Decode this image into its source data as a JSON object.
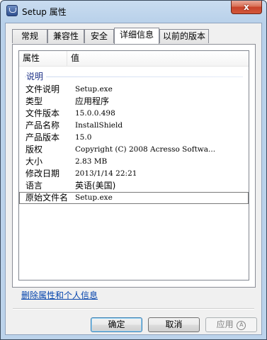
{
  "window": {
    "title": "Setup 属性",
    "close_glyph": "x"
  },
  "tabs": [
    {
      "label": "常规",
      "active": false
    },
    {
      "label": "兼容性",
      "active": false
    },
    {
      "label": "安全",
      "active": false
    },
    {
      "label": "详细信息",
      "active": true
    },
    {
      "label": "以前的版本",
      "active": false
    }
  ],
  "details": {
    "columns": [
      "属性",
      "值"
    ],
    "group_label": "说明",
    "rows": [
      {
        "name": "文件说明",
        "value": "Setup.exe"
      },
      {
        "name": "类型",
        "value": "应用程序"
      },
      {
        "name": "文件版本",
        "value": "15.0.0.498"
      },
      {
        "name": "产品名称",
        "value": "InstallShield"
      },
      {
        "name": "产品版本",
        "value": "15.0"
      },
      {
        "name": "版权",
        "value": "Copyright (C) 2008 Acresso Softwa..."
      },
      {
        "name": "大小",
        "value": "2.83 MB"
      },
      {
        "name": "修改日期",
        "value": "2013/1/14 22:21"
      },
      {
        "name": "语言",
        "value": "英语(美国)"
      },
      {
        "name": "原始文件名",
        "value": "Setup.exe",
        "selected": true
      }
    ]
  },
  "remove_link": "删除属性和个人信息",
  "buttons": {
    "ok": "确定",
    "cancel": "取消",
    "apply": "应用",
    "apply_accel": "A"
  },
  "colors": {
    "link": "#0645ad",
    "group_label": "#1e3287",
    "close_button": "#c7422a"
  },
  "icons": {
    "app": "setup-app-icon",
    "close": "close-icon"
  }
}
